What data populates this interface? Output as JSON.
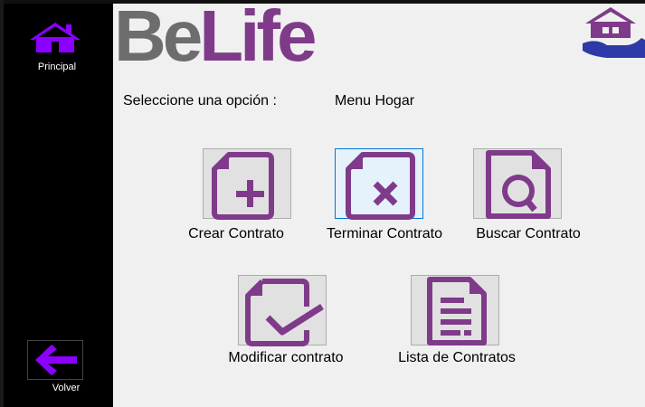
{
  "app": {
    "logo_part1": "Be",
    "logo_part2": "Life"
  },
  "sidebar": {
    "home_label": "Principal",
    "back_label": "Volver"
  },
  "header": {
    "prompt": "Seleccione una opción :",
    "menu_title": "Menu Hogar"
  },
  "actions": {
    "create": "Crear Contrato",
    "terminate": "Terminar Contrato",
    "search": "Buscar Contrato",
    "modify": "Modificar contrato",
    "list": "Lista de Contratos"
  },
  "colors": {
    "accent": "#7f3b8a",
    "icon_purple": "#8b00ff",
    "sidebar": "#000000"
  }
}
